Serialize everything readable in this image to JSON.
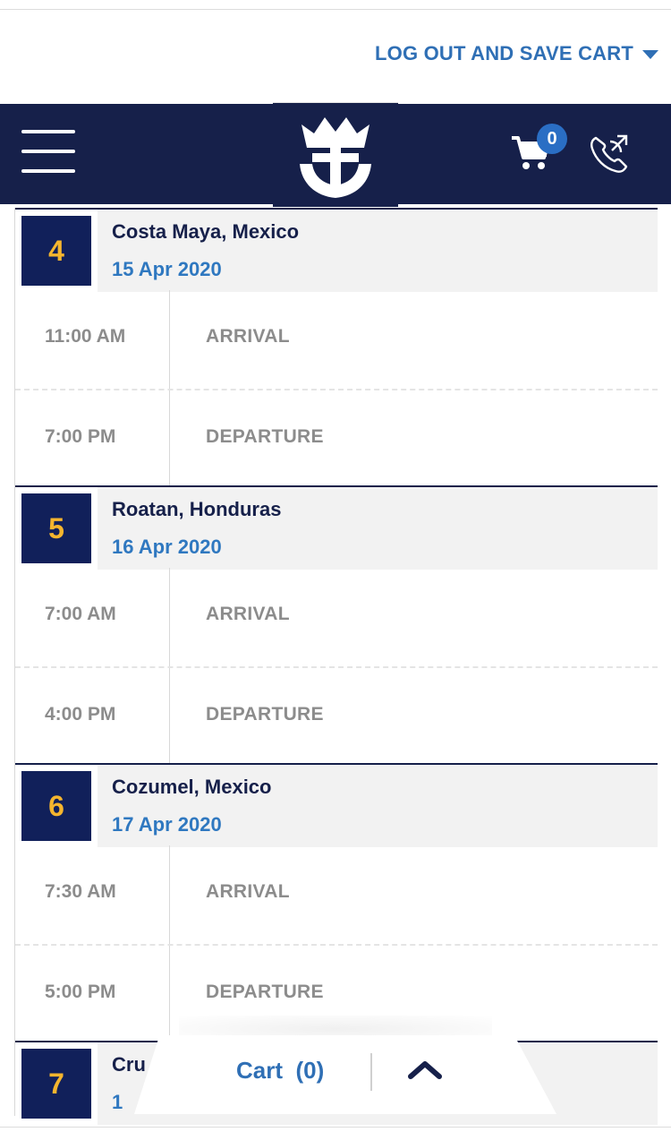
{
  "header": {
    "logout_label": "LOG OUT AND SAVE CART",
    "cart_count": "0"
  },
  "itinerary": {
    "days": [
      {
        "number": "4",
        "port": "Costa Maya, Mexico",
        "date": "15 Apr 2020",
        "events": [
          {
            "time": "11:00 AM",
            "label": "ARRIVAL"
          },
          {
            "time": "7:00 PM",
            "label": "DEPARTURE"
          }
        ]
      },
      {
        "number": "5",
        "port": "Roatan, Honduras",
        "date": "16 Apr 2020",
        "events": [
          {
            "time": "7:00 AM",
            "label": "ARRIVAL"
          },
          {
            "time": "4:00 PM",
            "label": "DEPARTURE"
          }
        ]
      },
      {
        "number": "6",
        "port": "Cozumel, Mexico",
        "date": "17 Apr 2020",
        "events": [
          {
            "time": "7:30 AM",
            "label": "ARRIVAL"
          },
          {
            "time": "5:00 PM",
            "label": "DEPARTURE"
          }
        ]
      },
      {
        "number": "7",
        "port": "Cru",
        "date": "1"
      }
    ]
  },
  "cart_bar": {
    "label": "Cart  (0)"
  },
  "colors": {
    "navy": "#16204a",
    "accent_blue": "#2f6fb5",
    "day_gold": "#f5b52e"
  },
  "icons": {
    "menu": "hamburger-icon",
    "logo": "crown-anchor-logo",
    "cart": "shopping-cart-icon",
    "phone": "phone-icon",
    "toggle": "chevron-up-icon"
  }
}
